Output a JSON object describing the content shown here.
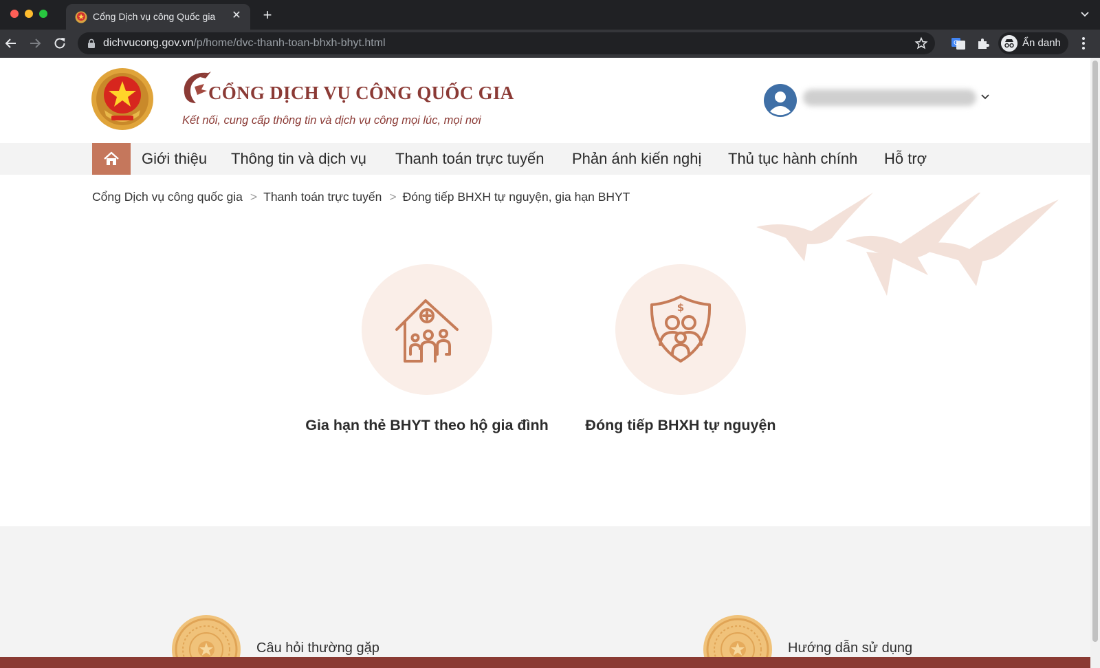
{
  "browser": {
    "tab_title": "Cổng Dịch vụ công Quốc gia",
    "url_host": "dichvucong.gov.vn",
    "url_path": "/p/home/dvc-thanh-toan-bhxh-bhyt.html",
    "profile_label": "Ẩn danh",
    "icons": [
      "back-icon",
      "forward-icon",
      "reload-icon",
      "lock-icon",
      "star-icon",
      "translate-icon",
      "extensions-icon",
      "incognito-icon",
      "menu-icon"
    ]
  },
  "header": {
    "title": "CỔNG DỊCH VỤ CÔNG QUỐC GIA",
    "subtitle": "Kết nối, cung cấp thông tin và dịch vụ công mọi lúc, mọi nơi"
  },
  "nav": {
    "items": [
      "Giới thiệu",
      "Thông tin và dịch vụ",
      "Thanh toán trực tuyến",
      "Phản ánh kiến nghị",
      "Thủ tục hành chính",
      "Hỗ trợ"
    ]
  },
  "breadcrumb": {
    "items": [
      "Cổng Dịch vụ công quốc gia",
      "Thanh toán trực tuyến",
      "Đóng tiếp BHXH tự nguyện, gia hạn BHYT"
    ],
    "separator": ">"
  },
  "services": [
    {
      "label": "Gia hạn thẻ BHYT theo hộ gia đình",
      "icon": "family-health-house-icon"
    },
    {
      "label": "Đóng tiếp BHXH tự nguyện",
      "icon": "family-insurance-shield-icon"
    }
  ],
  "footer_links": [
    "Câu hỏi thường gặp",
    "Hướng dẫn sử dụng"
  ],
  "colors": {
    "brand": "#8b3a35",
    "accent": "#c5775c",
    "icon_circle": "#faeee8",
    "footer_bar": "#8a3a33"
  }
}
